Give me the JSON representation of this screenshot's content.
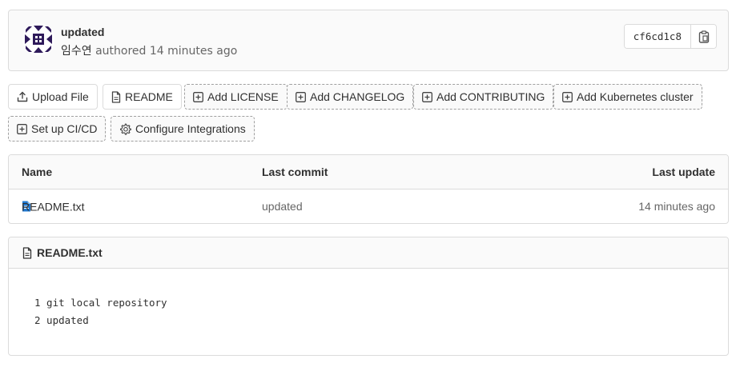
{
  "commit": {
    "title": "updated",
    "author": "임수연",
    "authored_text": "authored",
    "time": "14 minutes ago",
    "sha": "cf6cd1c8"
  },
  "actions": {
    "upload_file": "Upload File",
    "readme": "README",
    "add_license": "Add LICENSE",
    "add_changelog": "Add CHANGELOG",
    "add_contributing": "Add CONTRIBUTING",
    "add_kubernetes": "Add Kubernetes cluster",
    "setup_cicd": "Set up CI/CD",
    "configure_integrations": "Configure Integrations"
  },
  "table": {
    "headers": {
      "name": "Name",
      "last_commit": "Last commit",
      "last_update": "Last update"
    },
    "rows": [
      {
        "name": "README.txt",
        "last_commit": "updated",
        "last_update": "14 minutes ago"
      }
    ]
  },
  "readme": {
    "filename": "README.txt",
    "lines": [
      "1 git local repository",
      "2 updated"
    ]
  },
  "colors": {
    "border": "#dbdbdb",
    "header_bg": "#fafafa",
    "file_icon": "#1f78d1",
    "avatar": "#2e1a5a"
  }
}
